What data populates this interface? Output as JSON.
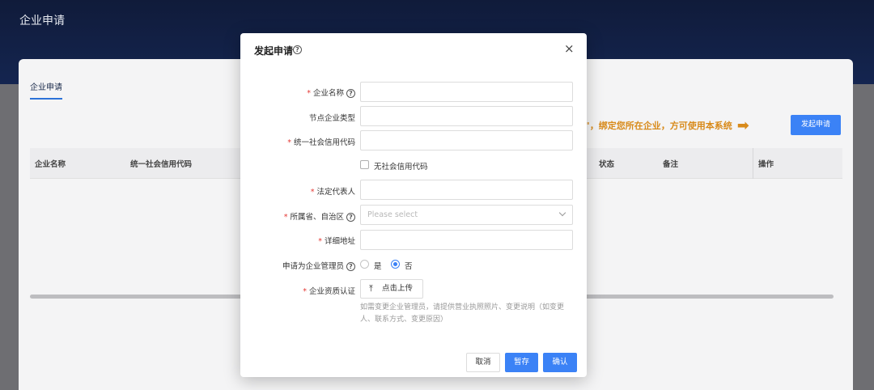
{
  "app": {
    "title": "企业申请"
  },
  "page": {
    "tab_label": "企业申请",
    "notice": "\"，绑定您所在企业，方可使用本系统",
    "notice_arrow": "➡",
    "apply_button": "发起申请",
    "table_headers": [
      "企业名称",
      "统一社会信用代码",
      "状态",
      "备注",
      "操作"
    ]
  },
  "modal": {
    "title": "发起申请",
    "help_glyph": "?",
    "close_glyph": "×",
    "fields": {
      "company_name": {
        "label": "企业名称",
        "required": "*",
        "value": ""
      },
      "node_type": {
        "label": "节点企业类型",
        "value": ""
      },
      "credit_code": {
        "label": "统一社会信用代码",
        "required": "*",
        "value": ""
      },
      "no_credit_code": {
        "label": "无社会信用代码",
        "checked": false
      },
      "legal_rep": {
        "label": "法定代表人",
        "required": "*",
        "value": ""
      },
      "province": {
        "label": "所属省、自治区",
        "required": "*",
        "placeholder": "Please select"
      },
      "address": {
        "label": "详细地址",
        "required": "*",
        "value": ""
      },
      "apply_admin": {
        "label": "申请为企业管理员",
        "options": [
          "是",
          "否"
        ],
        "selected": "否"
      },
      "qualification": {
        "label": "企业资质认证",
        "required": "*",
        "upload_label": "点击上传",
        "upload_icon": "⤒",
        "hint": "如需变更企业管理员，请提供营业执照照片、变更说明（如变更人、联系方式、变更原因）"
      }
    },
    "buttons": {
      "cancel": "取消",
      "draft": "暂存",
      "confirm": "确认"
    }
  },
  "colors": {
    "primary": "#3b82f6",
    "header_bg": "#101b3a",
    "warning": "#d88a1a",
    "required": "#e53935"
  }
}
